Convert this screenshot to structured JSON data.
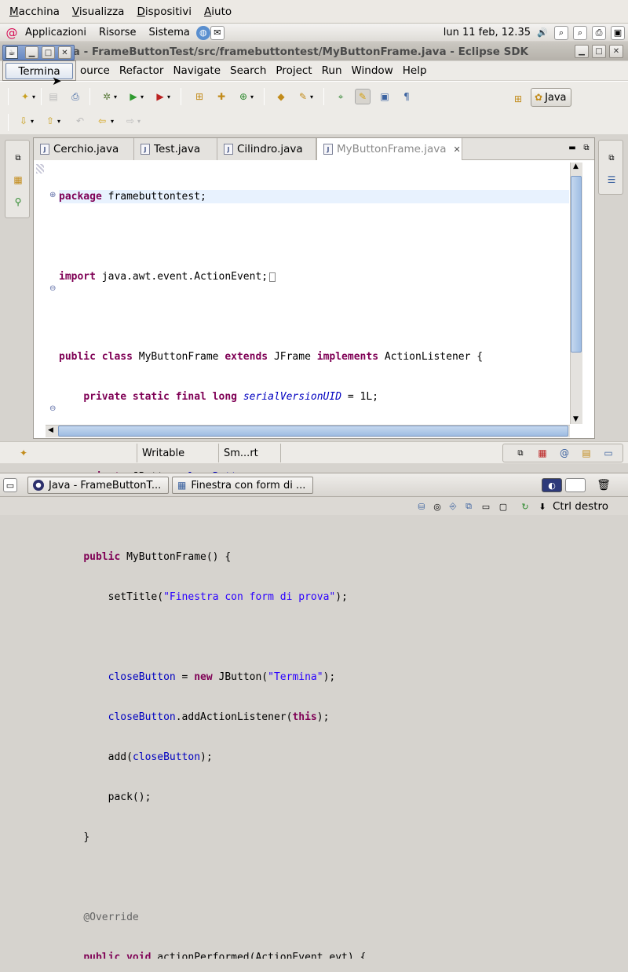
{
  "vm_menu": [
    {
      "label": "Macchina",
      "key": "M",
      "rest": "acchina"
    },
    {
      "label": "Visualizza",
      "key": "V",
      "rest": "isualizza"
    },
    {
      "label": "Dispositivi",
      "key": "D",
      "rest": "ispositivi"
    },
    {
      "label": "Aiuto",
      "key": "A",
      "rest": "iuto"
    }
  ],
  "panel": {
    "applications": "Applicazioni",
    "places": "Risorse",
    "system": "Sistema",
    "clock": "lun 11 feb, 12.35"
  },
  "eclipse": {
    "title": "va - FrameButtonTest/src/framebuttontest/MyButtonFrame.java - Eclipse SDK",
    "menu": [
      "ource",
      "Refactor",
      "Navigate",
      "Search",
      "Project",
      "Run",
      "Window",
      "Help"
    ],
    "perspective": "Java",
    "tabs": [
      {
        "label": "Cerchio.java"
      },
      {
        "label": "Test.java"
      },
      {
        "label": "Cilindro.java"
      },
      {
        "label": "MyButtonFrame.java"
      }
    ],
    "status": {
      "writable": "Writable",
      "insert_mode": "Sm...rt"
    }
  },
  "popup": {
    "button_label": "Termina"
  },
  "code": {
    "l1_kw": "package",
    "l1_rest": " framebuttontest;",
    "l3_kw": "import",
    "l3_rest": " java.awt.event.ActionEvent;",
    "l5_kw1": "public class",
    "l5_name": " MyButtonFrame ",
    "l5_kw2": "extends",
    "l5_mid": " JFrame ",
    "l5_kw3": "implements",
    "l5_end": " ActionListener {",
    "l6_kw": "private static final long",
    "l6_field": "serialVersionUID",
    "l6_end": " = 1L;",
    "l8_kw": "private",
    "l8_type": " JButton ",
    "l8_field": "closeButton",
    "l8_end": ";",
    "l10_kw": "public",
    "l10_rest": " MyButtonFrame() {",
    "l11_a": "setTitle(",
    "l11_str": "\"Finestra con form di prova\"",
    "l11_b": ");",
    "l13_field": "closeButton",
    "l13_a": " = ",
    "l13_kw": "new",
    "l13_b": " JButton(",
    "l13_str": "\"Termina\"",
    "l13_c": ");",
    "l14_field": "closeButton",
    "l14_a": ".addActionListener(",
    "l14_kw": "this",
    "l14_b": ");",
    "l15_a": "add(",
    "l15_field": "closeButton",
    "l15_b": ");",
    "l16": "pack();",
    "l17": "}",
    "l19": "@Override",
    "l20_kw": "public void",
    "l20_rest": " actionPerformed(ActionEvent evt) {"
  },
  "taskbar": {
    "tasks": [
      "Java - FrameButtonT...",
      "Finestra con form di ..."
    ]
  },
  "hostbar": {
    "hostkey": "Ctrl destro"
  }
}
